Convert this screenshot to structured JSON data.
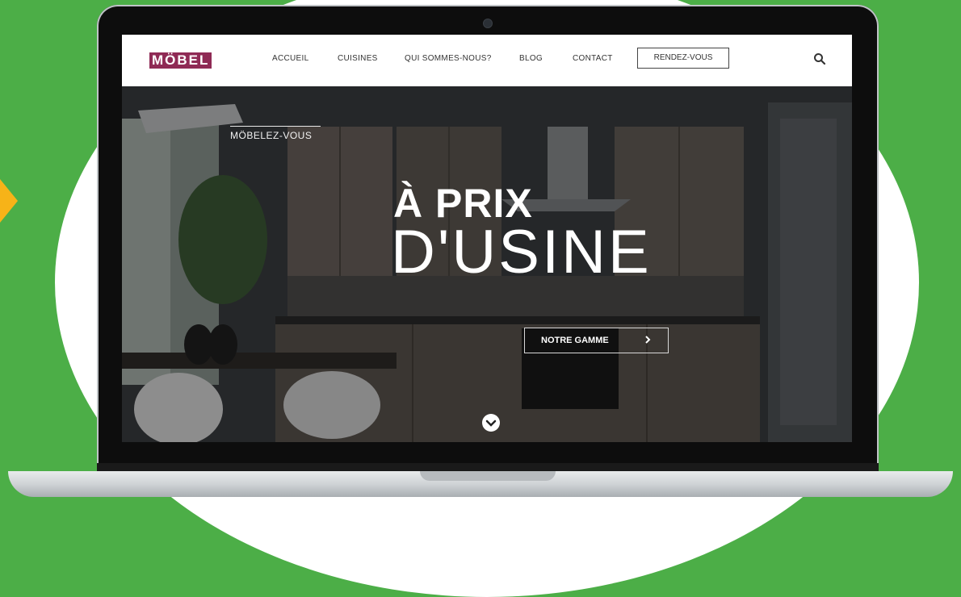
{
  "site": {
    "logo_text": "MÖBEL"
  },
  "nav": {
    "links": [
      {
        "label": "ACCUEIL"
      },
      {
        "label": "CUISINES"
      },
      {
        "label": "QUI SOMMES-NOUS?"
      },
      {
        "label": "BLOG"
      },
      {
        "label": "CONTACT"
      }
    ],
    "cta_label": "RENDEZ-VOUS",
    "search_icon": "search-icon"
  },
  "hero": {
    "kicker": "MÖBELEZ-VOUS",
    "headline_line1": "À PRIX",
    "headline_line2": "D'USINE",
    "cta_label": "NOTRE GAMME",
    "cta_icon": "chevron-right-icon",
    "scroll_icon": "chevron-down-icon"
  },
  "colors": {
    "background": "#4cae47",
    "accent": "#f7b318",
    "logo": "#8f2a55"
  }
}
